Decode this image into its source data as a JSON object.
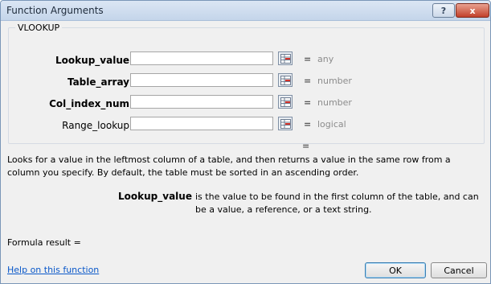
{
  "window": {
    "title": "Function Arguments",
    "help_glyph": "?",
    "close_glyph": "x"
  },
  "function": {
    "name": "VLOOKUP"
  },
  "arguments": [
    {
      "label": "Lookup_value",
      "bold": true,
      "value": "",
      "type": "any"
    },
    {
      "label": "Table_array",
      "bold": true,
      "value": "",
      "type": "number"
    },
    {
      "label": "Col_index_num",
      "bold": true,
      "value": "",
      "type": "number"
    },
    {
      "label": "Range_lookup",
      "bold": false,
      "value": "",
      "type": "logical"
    }
  ],
  "equals_sign": "=",
  "result_equals": "=",
  "description": "Looks for a value in the leftmost column of a table, and then returns a value in the same row from a column you specify. By default, the table must be sorted in an ascending order.",
  "argument_help": {
    "name": "Lookup_value",
    "text": "is the value to be found in the first column of the table, and can be a value, a reference, or a text string."
  },
  "formula_result": "Formula result =",
  "help_link": "Help on this function",
  "buttons": {
    "ok": "OK",
    "cancel": "Cancel"
  },
  "icons": {
    "collapse": "range-selector-icon"
  }
}
